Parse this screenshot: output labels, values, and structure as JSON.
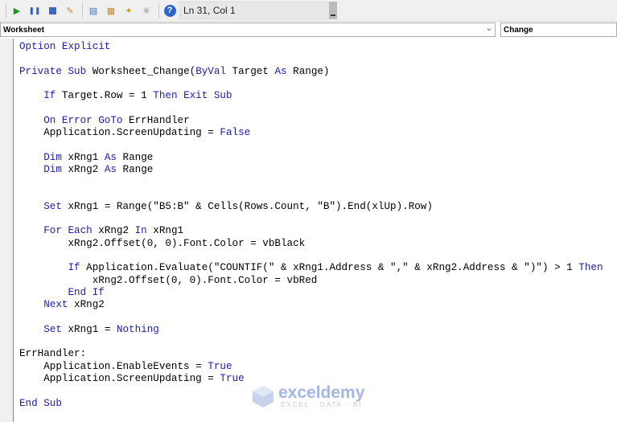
{
  "toolbar": {
    "icons": [
      "run-icon",
      "break-icon",
      "reset-icon",
      "design-mode-icon",
      "project-explorer-icon",
      "properties-icon",
      "object-browser-icon",
      "toolbox-icon",
      "help-icon"
    ],
    "status": "Ln 31, Col 1"
  },
  "object_select": {
    "value": "Worksheet"
  },
  "procedure_select": {
    "value": "Change"
  },
  "colors": {
    "keyword": "#1c1ca8",
    "text": "#000000"
  },
  "code_lines": [
    [
      [
        "Option Explicit",
        "kw"
      ]
    ],
    [],
    [
      [
        "Private Sub ",
        "kw"
      ],
      [
        "Worksheet_Change(",
        ""
      ],
      [
        "ByVal ",
        "kw"
      ],
      [
        "Target ",
        ""
      ],
      [
        "As ",
        "kw"
      ],
      [
        "Range)",
        ""
      ]
    ],
    [],
    [
      [
        "    If ",
        "kw"
      ],
      [
        "Target.Row = 1 ",
        ""
      ],
      [
        "Then Exit Sub",
        "kw"
      ]
    ],
    [],
    [
      [
        "    On Error GoTo ",
        "kw"
      ],
      [
        "ErrHandler",
        ""
      ]
    ],
    [
      [
        "    Application.ScreenUpdating = ",
        ""
      ],
      [
        "False",
        "kw"
      ]
    ],
    [],
    [
      [
        "    Dim ",
        "kw"
      ],
      [
        "xRng1 ",
        ""
      ],
      [
        "As ",
        "kw"
      ],
      [
        "Range",
        ""
      ]
    ],
    [
      [
        "    Dim ",
        "kw"
      ],
      [
        "xRng2 ",
        ""
      ],
      [
        "As ",
        "kw"
      ],
      [
        "Range",
        ""
      ]
    ],
    [],
    [],
    [
      [
        "    Set ",
        "kw"
      ],
      [
        "xRng1 = Range(\"B5:B\" & Cells(Rows.Count, \"B\").End(xlUp).Row)",
        ""
      ]
    ],
    [],
    [
      [
        "    For Each ",
        "kw"
      ],
      [
        "xRng2 ",
        ""
      ],
      [
        "In ",
        "kw"
      ],
      [
        "xRng1",
        ""
      ]
    ],
    [
      [
        "        xRng2.Offset(0, 0).Font.Color = vbBlack",
        ""
      ]
    ],
    [],
    [
      [
        "        If ",
        "kw"
      ],
      [
        "Application.Evaluate(\"COUNTIF(\" & xRng1.Address & \",\" & xRng2.Address & \")\") > 1 ",
        ""
      ],
      [
        "Then",
        "kw"
      ]
    ],
    [
      [
        "            xRng2.Offset(0, 0).Font.Color = vbRed",
        ""
      ]
    ],
    [
      [
        "        End If",
        "kw"
      ]
    ],
    [
      [
        "    Next ",
        "kw"
      ],
      [
        "xRng2",
        ""
      ]
    ],
    [],
    [
      [
        "    Set ",
        "kw"
      ],
      [
        "xRng1 = ",
        ""
      ],
      [
        "Nothing",
        "kw"
      ]
    ],
    [],
    [
      [
        "ErrHandler:",
        ""
      ]
    ],
    [
      [
        "    Application.EnableEvents = ",
        ""
      ],
      [
        "True",
        "kw"
      ]
    ],
    [
      [
        "    Application.ScreenUpdating = ",
        ""
      ],
      [
        "True",
        "kw"
      ]
    ],
    [],
    [
      [
        "End Sub",
        "kw"
      ]
    ]
  ],
  "watermark": {
    "name": "exceldemy",
    "tagline": "EXCEL · DATA · BI"
  }
}
